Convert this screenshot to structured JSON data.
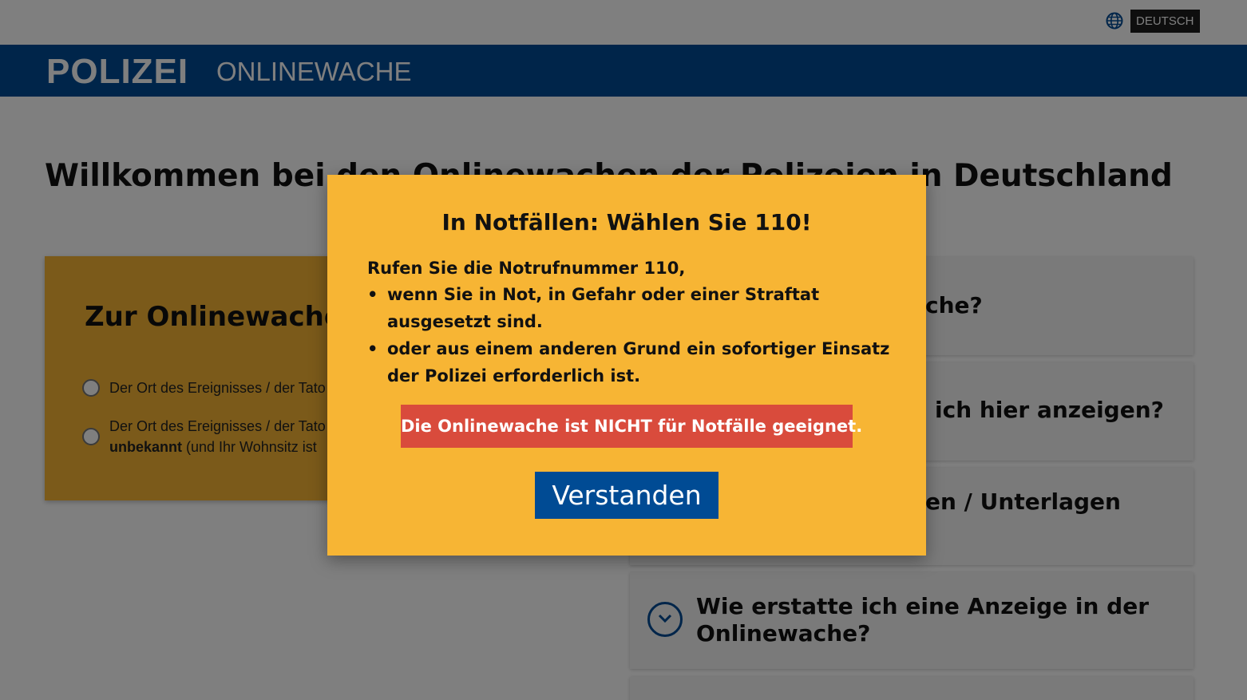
{
  "topbar": {
    "language_icon": "globe-icon",
    "language_label": "DEUTSCH"
  },
  "header": {
    "brand": "POLIZEI",
    "brand_sub": "ONLINEWACHE"
  },
  "main": {
    "title": "Willkommen bei den Onlinewachen der Polizeien in Deutschland",
    "left_card": {
      "heading": "Zur Onlinewache",
      "options": [
        {
          "text": "Der Ort des Ereignisses / der Tato"
        },
        {
          "text_line1": "Der Ort des Ereignisses / der Tato",
          "text_bold": "unbekannt",
          "text_rest": " (und Ihr Wohnsitz ist"
        }
      ]
    },
    "faq": [
      {
        "text": "che?"
      },
      {
        "text": "ich hier anzeigen?"
      },
      {
        "text": "en / Unterlagen"
      },
      {
        "line1": "Wie erstatte ich eine Anzeige in der",
        "line2": "Onlinewache?",
        "icon": "chevron-down-circle-icon"
      }
    ]
  },
  "modal": {
    "title": "In Notfällen: Wählen Sie 110!",
    "intro": "Rufen Sie die Notrufnummer 110,",
    "bullets": [
      "wenn Sie in Not, in Gefahr oder einer Straftat ausgesetzt sind.",
      "oder aus einem anderen Grund ein sofortiger Einsatz der Polizei erforderlich ist."
    ],
    "warning": "Die Onlinewache ist NICHT für Notfälle geeignet.",
    "confirm_label": "Verstanden"
  },
  "colors": {
    "header_blue": "#004b94",
    "card_yellow": "#f7b534",
    "warning_red": "#d94b3c"
  }
}
